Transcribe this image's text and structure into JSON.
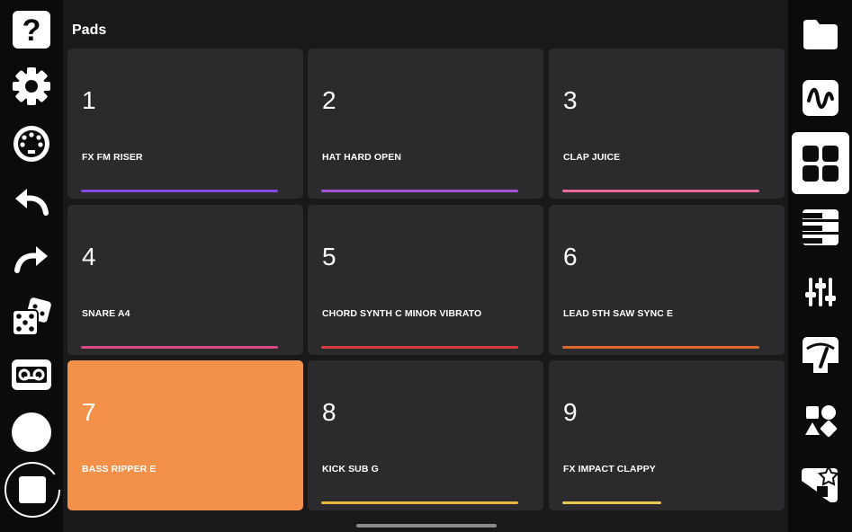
{
  "page": {
    "title": "Pads"
  },
  "left_toolbar": [
    {
      "name": "help-icon"
    },
    {
      "name": "settings-gear-icon"
    },
    {
      "name": "midi-icon"
    },
    {
      "name": "undo-icon"
    },
    {
      "name": "redo-icon"
    },
    {
      "name": "dice-randomize-icon"
    },
    {
      "name": "tape-record-icon"
    },
    {
      "name": "record-button-icon"
    },
    {
      "name": "stop-button-icon"
    }
  ],
  "right_toolbar": [
    {
      "name": "folder-icon"
    },
    {
      "name": "waveform-icon"
    },
    {
      "name": "pads-grid-icon",
      "selected": true
    },
    {
      "name": "piano-keys-icon"
    },
    {
      "name": "mixer-sliders-icon"
    },
    {
      "name": "meter-icon"
    },
    {
      "name": "shapes-icon"
    },
    {
      "name": "export-star-icon"
    }
  ],
  "pads": [
    {
      "number": "1",
      "name": "FX FM RISER",
      "color": "#8a49e0",
      "active": false,
      "bar_fill": 1.0
    },
    {
      "number": "2",
      "name": "HAT HARD OPEN",
      "color": "#a552d8",
      "active": false,
      "bar_fill": 1.0
    },
    {
      "number": "3",
      "name": "CLAP JUICE",
      "color": "#e66a9b",
      "active": false,
      "bar_fill": 1.0
    },
    {
      "number": "4",
      "name": "SNARE A4",
      "color": "#d84a86",
      "active": false,
      "bar_fill": 1.0
    },
    {
      "number": "5",
      "name": "CHORD SYNTH C MINOR VIBRATO",
      "color": "#d93a3c",
      "active": false,
      "bar_fill": 1.0
    },
    {
      "number": "6",
      "name": "LEAD 5TH SAW SYNC E",
      "color": "#e0672c",
      "active": false,
      "bar_fill": 1.0
    },
    {
      "number": "7",
      "name": "BASS RIPPER E",
      "color": "#f3914b",
      "active": true,
      "bar_fill": 0.0
    },
    {
      "number": "8",
      "name": "KICK SUB G",
      "color": "#e8b93a",
      "active": false,
      "bar_fill": 1.0
    },
    {
      "number": "9",
      "name": "FX IMPACT CLAPPY",
      "color": "#e8c94d",
      "active": false,
      "bar_fill": 0.5
    }
  ],
  "colors": {
    "active_pad": "#f3914b",
    "pad_bg": "#2b2b2e",
    "background": "#19191a"
  }
}
